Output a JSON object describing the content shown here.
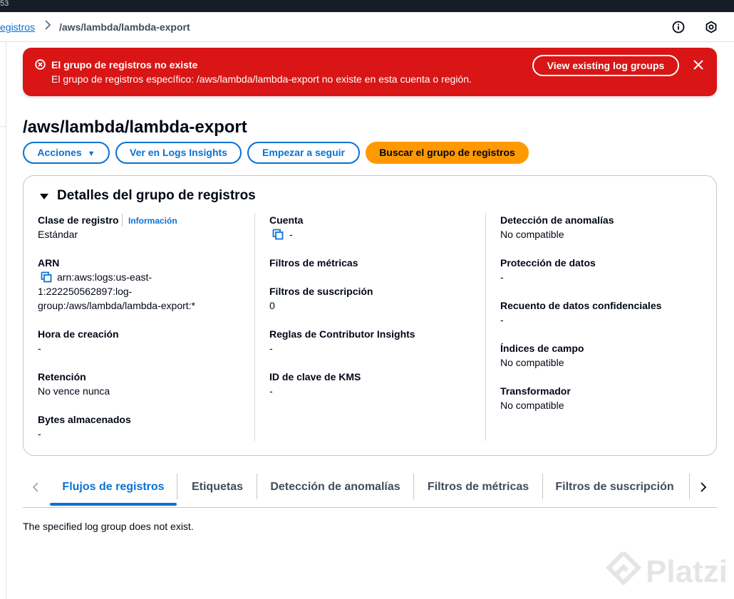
{
  "topbar": {
    "text": "53"
  },
  "breadcrumb": {
    "parent_label": "egistros",
    "current_label": "/aws/lambda/lambda-export"
  },
  "alert": {
    "title": "El grupo de registros no existe",
    "message": "El grupo de registros específico: /aws/lambda/lambda-export no existe en esta cuenta o región.",
    "button_label": "View existing log groups",
    "icon": "error-icon",
    "color": "#d91515"
  },
  "page": {
    "title": "/aws/lambda/lambda-export"
  },
  "actions": {
    "acciones_label": "Acciones",
    "logs_insights_label": "Ver en Logs Insights",
    "seguir_label": "Empezar a seguir",
    "buscar_label": "Buscar el grupo de registros",
    "primary_color": "#ff9900"
  },
  "details": {
    "title": "Detalles del grupo de registros",
    "col1": {
      "clase_label": "Clase de registro",
      "info_link": "Información",
      "clase_value": "Estándar",
      "arn_label": "ARN",
      "arn_line1": "arn:aws:logs:us-east-",
      "arn_line2": "1:222250562897:log-",
      "arn_line3": "group:/aws/lambda/lambda-export:*",
      "hora_label": "Hora de creación",
      "hora_value": "-",
      "retencion_label": "Retención",
      "retencion_value": "No vence nunca",
      "bytes_label": "Bytes almacenados",
      "bytes_value": "-"
    },
    "col2": {
      "cuenta_label": "Cuenta",
      "cuenta_value": "-",
      "filtros_metricas_label": "Filtros de métricas",
      "filtros_suscripcion_label": "Filtros de suscripción",
      "filtros_suscripcion_value": "0",
      "contributor_label": "Reglas de Contributor Insights",
      "contributor_value": "-",
      "kms_label": "ID de clave de KMS",
      "kms_value": "-"
    },
    "col3": {
      "anomalias_label": "Detección de anomalías",
      "anomalias_value": "No compatible",
      "proteccion_label": "Protección de datos",
      "proteccion_value": "-",
      "recuento_label": "Recuento de datos confidenciales",
      "recuento_value": "-",
      "indices_label": "Índices de campo",
      "indices_value": "No compatible",
      "transformador_label": "Transformador",
      "transformador_value": "No compatible"
    }
  },
  "tabs": [
    {
      "label": "Flujos de registros",
      "active": true
    },
    {
      "label": "Etiquetas",
      "active": false
    },
    {
      "label": "Detección de anomalías",
      "active": false
    },
    {
      "label": "Filtros de métricas",
      "active": false
    },
    {
      "label": "Filtros de suscripción",
      "active": false
    }
  ],
  "content": {
    "empty_message": "The specified log group does not exist."
  },
  "watermark": {
    "text": "Platzi"
  }
}
